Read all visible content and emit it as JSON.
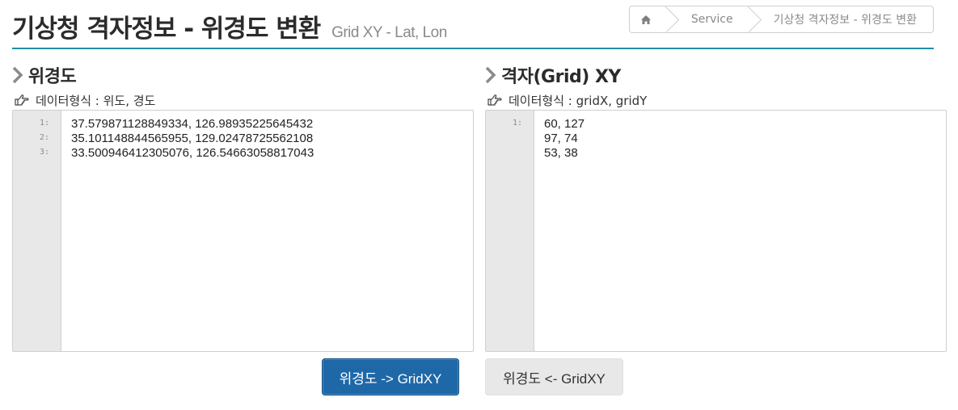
{
  "page": {
    "title": "기상청 격자정보 - 위경도 변환",
    "subtitle": "Grid XY - Lat, Lon"
  },
  "breadcrumb": {
    "home_icon": "home-icon",
    "items": [
      "Service",
      "기상청 격자정보 - 위경도 변환"
    ]
  },
  "left_panel": {
    "title": "위경도",
    "format_label": "데이터형식 : 위도, 경도",
    "line_numbers": [
      "1:",
      "2:",
      "3:"
    ],
    "lines": [
      "37.579871128849334, 126.98935225645432",
      "35.101148844565955, 129.02478725562108",
      "33.500946412305076, 126.54663058817043"
    ]
  },
  "right_panel": {
    "title": "격자(Grid) XY",
    "format_label": "데이터형식 : gridX, gridY",
    "line_numbers": [
      "1:"
    ],
    "lines": [
      "60, 127",
      "97, 74",
      "53, 38"
    ]
  },
  "buttons": {
    "to_grid": "위경도 -> GridXY",
    "to_latlon": "위경도 <- GridXY"
  },
  "colors": {
    "accent_line": "#1f8ea8",
    "primary_button": "#1f68a8",
    "default_button": "#e8e8e8",
    "gutter": "#e8e8e8"
  }
}
